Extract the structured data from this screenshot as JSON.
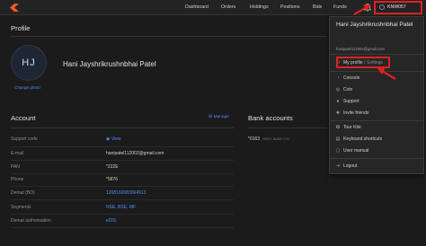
{
  "nav": {
    "dashboard": "Dashboard",
    "orders": "Orders",
    "holdings": "Holdings",
    "positions": "Positions",
    "bids": "Bids",
    "funds": "Funds",
    "user_id": "KNW057"
  },
  "profile": {
    "section_title": "Profile",
    "initials": "HJ",
    "change_photo": "Change photo",
    "full_name": "Hani Jayshrikrushnbhai Patel"
  },
  "account": {
    "section_title": "Account",
    "manage": "Manage",
    "rows": [
      {
        "label": "Support code",
        "value": "View"
      },
      {
        "label": "E-mail",
        "value": "hanipatel112002@gmail.com"
      },
      {
        "label": "PAN",
        "value": "*222E"
      },
      {
        "label": "Phone",
        "value": "*5876"
      },
      {
        "label": "Demat (BO)",
        "value": "1208160083064913"
      },
      {
        "label": "Segments",
        "value": "NSE, BSE, MF"
      },
      {
        "label": "Demat authorisation",
        "value": "eDIS"
      }
    ]
  },
  "bank": {
    "section_title": "Bank accounts",
    "account": "*0163",
    "bank_name": "HDFC BANK LTD"
  },
  "menu": {
    "name": "Hani Jayshrikrushnbhai Patel",
    "email": "hanipatel112002@gmail.com",
    "my_profile": "My profile",
    "settings": "/ Settings",
    "items": {
      "console": "Console",
      "coin": "Coin",
      "support": "Support",
      "invite": "Invite friends",
      "tour": "Tour Kite",
      "shortcuts": "Keyboard shortcuts",
      "manual": "User manual",
      "logout": "Logout"
    }
  },
  "colors": {
    "background": "#1b1b1b",
    "link": "#4f8ff7",
    "highlight": "#e02020"
  }
}
